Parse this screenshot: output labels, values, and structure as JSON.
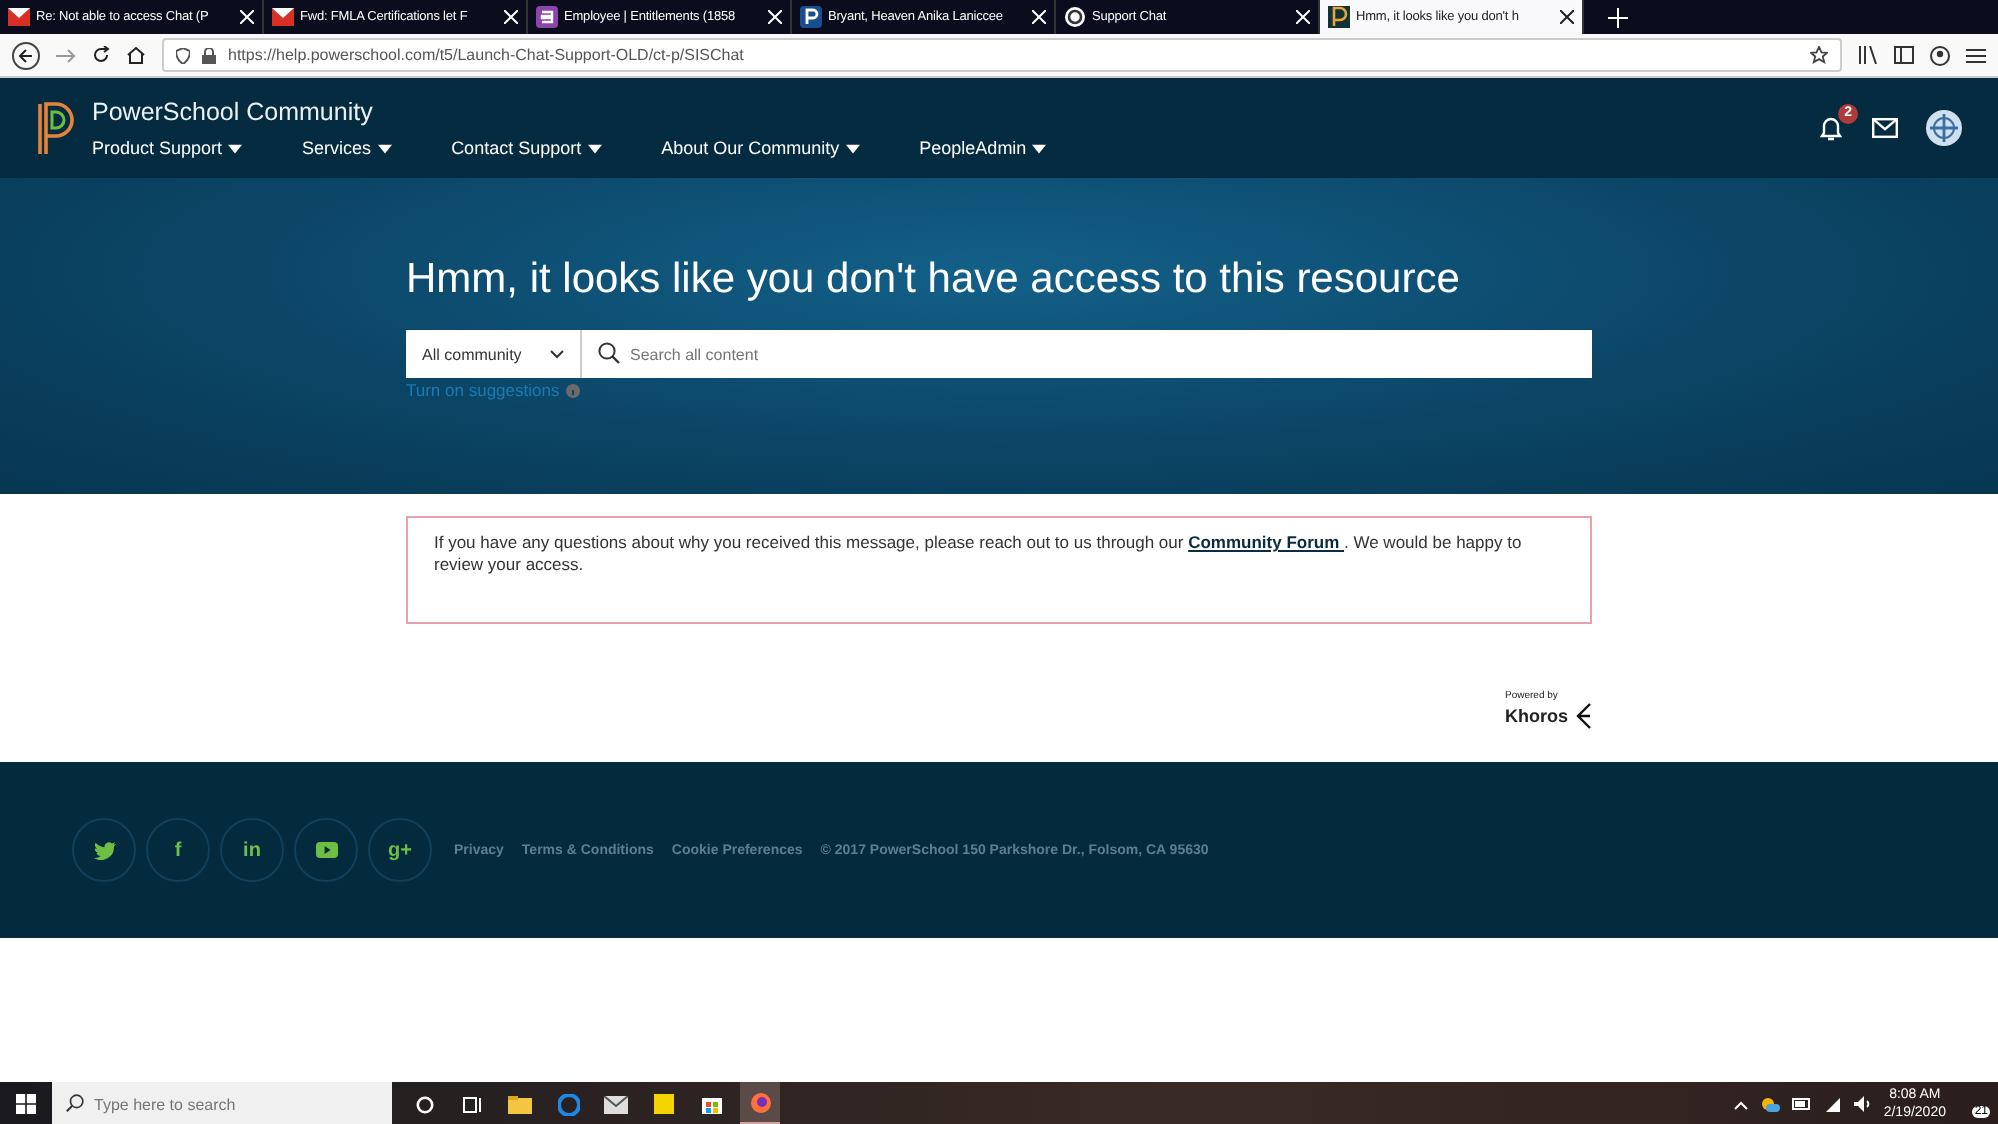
{
  "browser": {
    "tabs": [
      {
        "title": "Re: Not able to access Chat (P",
        "kind": "mail",
        "selected": false
      },
      {
        "title": "Fwd: FMLA Certifications let F",
        "kind": "mail",
        "selected": false
      },
      {
        "title": "Employee | Entitlements (1858",
        "kind": "s",
        "selected": false
      },
      {
        "title": "Bryant, Heaven Anika Laniccee",
        "kind": "p",
        "selected": false
      },
      {
        "title": "Support Chat",
        "kind": "chat",
        "selected": false
      },
      {
        "title": "Hmm, it looks like you don't h",
        "kind": "ps",
        "selected": true
      }
    ],
    "url": "https://help.powerschool.com/t5/Launch-Chat-Support-OLD/ct-p/SISChat"
  },
  "header": {
    "site_title": "PowerSchool Community",
    "nav": [
      "Product Support",
      "Services",
      "Contact Support",
      "About Our Community",
      "PeopleAdmin"
    ],
    "notification_count": "2"
  },
  "hero": {
    "heading": "Hmm, it looks like you don't have access to this resource",
    "scope": "All community",
    "search": {
      "placeholder": "Search all content"
    },
    "suggestions_link": "Turn on suggestions"
  },
  "message": {
    "text": "If you have any questions about why you received this message, please reach out to us through our",
    "link": "Community Forum ",
    "text_after": ". We would be happy to review your access."
  },
  "powered_by": {
    "label": "Powered by",
    "brand": "Khoros"
  },
  "footer": {
    "social": [
      {
        "kind": "twitter"
      },
      {
        "kind": "text",
        "glyph": "f"
      },
      {
        "kind": "text",
        "glyph": "in"
      },
      {
        "kind": "youtube"
      },
      {
        "kind": "text",
        "glyph": "g+"
      }
    ],
    "links": [
      "Privacy",
      "Terms & Conditions",
      "Cookie Preferences"
    ],
    "copyright": "© 2017 PowerSchool 150 Parkshore Dr., Folsom, CA 95630"
  },
  "taskbar": {
    "search": {
      "placeholder": "Type here to search"
    },
    "time": "8:08 AM",
    "date": "2/19/2020",
    "notifications": "21"
  }
}
